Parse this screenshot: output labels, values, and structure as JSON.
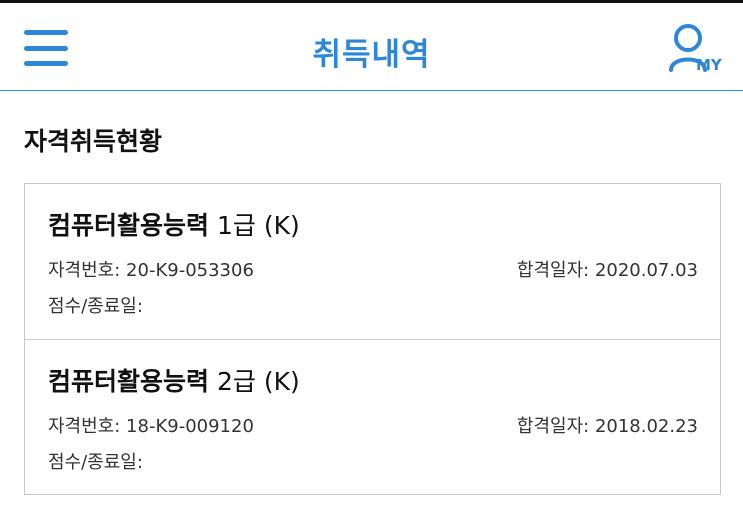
{
  "header": {
    "title": "취득내역",
    "menu_icon": "hamburger-menu-icon",
    "profile_icon": "user-profile-icon",
    "profile_label": "MY",
    "accent_color": "#2e86d8"
  },
  "section": {
    "title": "자격취득현황"
  },
  "certificates": [
    {
      "name_prefix": "컴퓨터활용능력",
      "name_level": " 1급 (K)",
      "number_label": "자격번호:",
      "number": "20-K9-053306",
      "pass_date_label": "합격일자:",
      "pass_date": "2020.07.03",
      "score_label": "점수/종료일:",
      "score": ""
    },
    {
      "name_prefix": "컴퓨터활용능력",
      "name_level": " 2급 (K)",
      "number_label": "자격번호:",
      "number": "18-K9-009120",
      "pass_date_label": "합격일자:",
      "pass_date": "2018.02.23",
      "score_label": "점수/종료일:",
      "score": ""
    }
  ]
}
